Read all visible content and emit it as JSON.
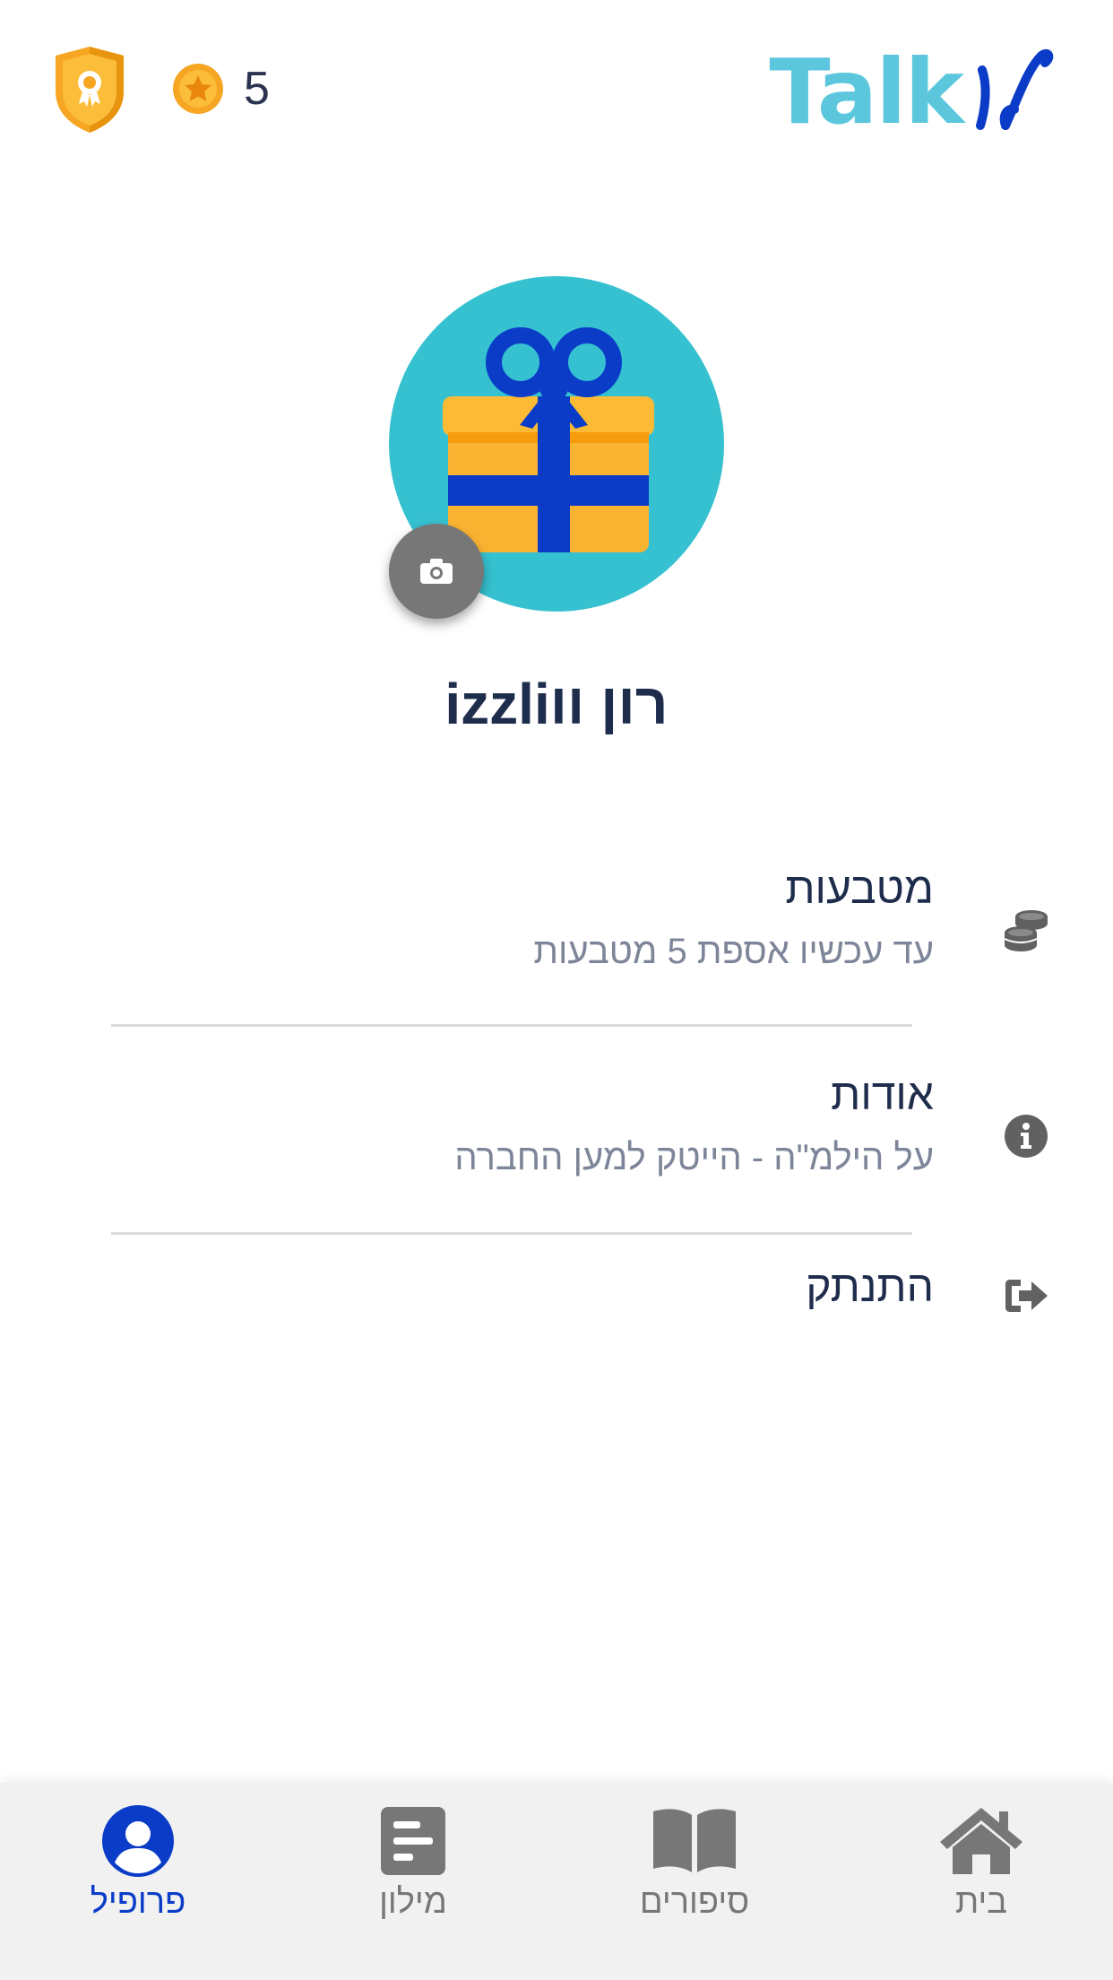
{
  "header": {
    "coins_count": "5",
    "logo_text": "Talk"
  },
  "profile": {
    "name": "רון ווizzli"
  },
  "menu": {
    "items": [
      {
        "title": "מטבעות",
        "subtitle": "עד עכשיו אספת 5 מטבעות",
        "icon": "coins-stack-icon"
      },
      {
        "title": "אודות",
        "subtitle": "על הילמ\"ה - הייטק למען החברה",
        "icon": "info-icon"
      },
      {
        "title": "התנתק",
        "icon": "logout-icon"
      }
    ]
  },
  "bottom_nav": {
    "items": [
      {
        "label": "פרופיל",
        "icon": "profile-icon",
        "active": true
      },
      {
        "label": "מילון",
        "icon": "dictionary-icon",
        "active": false
      },
      {
        "label": "סיפורים",
        "icon": "book-icon",
        "active": false
      },
      {
        "label": "בית",
        "icon": "home-icon",
        "active": false
      }
    ]
  },
  "colors": {
    "accent": "#0a3cc8",
    "avatar_bg": "#36c1d1",
    "logo": "#5cc7dc",
    "gift_box": "#fbb431",
    "ribbon": "#0a3cc8"
  }
}
